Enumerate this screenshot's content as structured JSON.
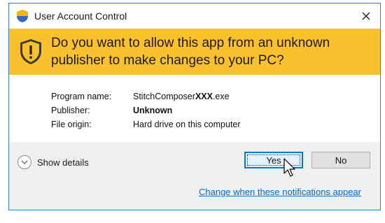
{
  "window": {
    "title": "User Account Control"
  },
  "banner": {
    "question": "Do you want to allow this app from an unknown publisher to make changes to your PC?",
    "color": "#fbc02d"
  },
  "details": {
    "program_name_label": "Program name:",
    "program_name_value_prefix": "StitchComposer",
    "program_name_value_bold": "XXX",
    "program_name_value_suffix": ".exe",
    "publisher_label": "Publisher:",
    "publisher_value": "Unknown",
    "file_origin_label": "File origin:",
    "file_origin_value": "Hard drive on this computer"
  },
  "footer": {
    "show_details_label": "Show details",
    "yes_label": "Yes",
    "no_label": "No",
    "change_link": "Change when these notifications appear"
  },
  "icons": {
    "title": "shield-icon",
    "banner": "warning-shield-icon",
    "close": "close-icon",
    "toggle": "chevron-down-icon",
    "cursor": "mouse-cursor-icon"
  }
}
